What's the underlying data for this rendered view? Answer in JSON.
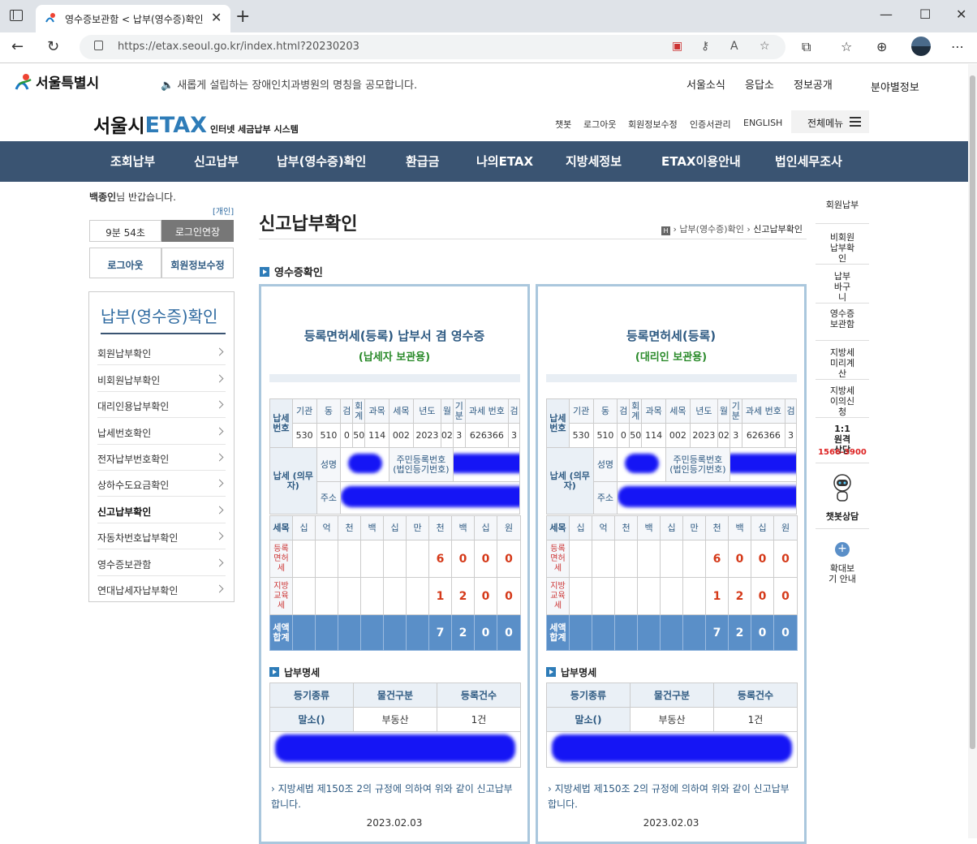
{
  "browser": {
    "tab_title": "영수증보관함 < 납부(영수증)확인",
    "url": "https://etax.seoul.go.kr/index.html?20230203"
  },
  "site": {
    "city_logo": "서울특별시",
    "notice": "새롭게 설립하는 장애인치과병원의 명칭을 공모합니다.",
    "top_links": [
      "서울소식",
      "응답소",
      "정보공개",
      "분야별정보"
    ],
    "brand_city": "서울시",
    "brand_etax": "ETAX",
    "brand_sub": "인터넷 세금납부 시스템",
    "util_links": [
      "챗봇",
      "로그아웃",
      "회원정보수정",
      "인증서관리",
      "ENGLISH"
    ],
    "all_menu": "전체메뉴"
  },
  "main_nav": [
    "조회납부",
    "신고납부",
    "납부(영수증)확인",
    "환급금",
    "나의ETAX",
    "지방세정보",
    "ETAX이용안내",
    "법인세무조사"
  ],
  "quick_menu": [
    "회원납부",
    "비회원 납부확인",
    "납부 바구니",
    "영수증 보관함",
    "지방세 미리계산",
    "지방세 이의신청",
    "1:1 원격 상담",
    "1566-3900",
    "챗봇상담",
    "확대보기 안내"
  ],
  "sidebar": {
    "greeting_name": "백종인",
    "greeting_rest": "님 반갑습니다.",
    "personal": "[개인]",
    "timer": "9분 54초",
    "extend": "로그인연장",
    "logout": "로그아웃",
    "edit_profile": "회원정보수정",
    "title": "납부(영수증)확인",
    "items": [
      "회원납부확인",
      "비회원납부확인",
      "대리인용납부확인",
      "납세번호확인",
      "전자납부번호확인",
      "상하수도요금확인",
      "신고납부확인",
      "자동차번호납부확인",
      "영수증보관함",
      "연대납세자납부확인"
    ]
  },
  "content": {
    "page_title": "신고납부확인",
    "breadcrumb_home": "H",
    "breadcrumb": [
      "납부(영수증)확인",
      "신고납부확인"
    ],
    "section_title": "영수증확인"
  },
  "receipts": [
    {
      "title": "등록면허세(등록) 납부서 겸 영수증",
      "subtitle": "(납세자 보관용)"
    },
    {
      "title": "등록면허세(등록)",
      "subtitle": "(대리인 보관용)"
    }
  ],
  "receipt_table": {
    "taxno_label": "납세 번호",
    "taxno_headers": [
      "기관",
      "동",
      "검",
      "회계",
      "과목",
      "세목",
      "년도",
      "월",
      "기분",
      "과세 번호",
      "검"
    ],
    "taxno_values": [
      "530",
      "510",
      "0",
      "50",
      "114",
      "002",
      "2023",
      "02",
      "3",
      "626366",
      "3"
    ],
    "payer_label": "납세 (의무자)",
    "name_label": "성명",
    "idno_label": "주민등록번호 (법인등기번호)",
    "addr_label": "주소",
    "digit_headers": [
      "세목",
      "십",
      "억",
      "천",
      "백",
      "십",
      "만",
      "천",
      "백",
      "십",
      "원"
    ],
    "rows": [
      {
        "label": "등록 면허 세",
        "digits": [
          "6",
          "0",
          "0",
          "0"
        ]
      },
      {
        "label": "지방 교육 세",
        "digits": [
          "1",
          "2",
          "0",
          "0"
        ]
      }
    ],
    "total_label": "세액 합계",
    "total_digits": [
      "7",
      "2",
      "0",
      "0"
    ]
  },
  "payment": {
    "title": "납부명세",
    "headers": [
      "등기종류",
      "물건구분",
      "등록건수"
    ],
    "row": [
      "말소()",
      "부동산",
      "1건"
    ],
    "note": "지방세법 제150조 2의 규정에 의하여 위와 같이 신고납부합니다.",
    "date": "2023.02.03"
  }
}
